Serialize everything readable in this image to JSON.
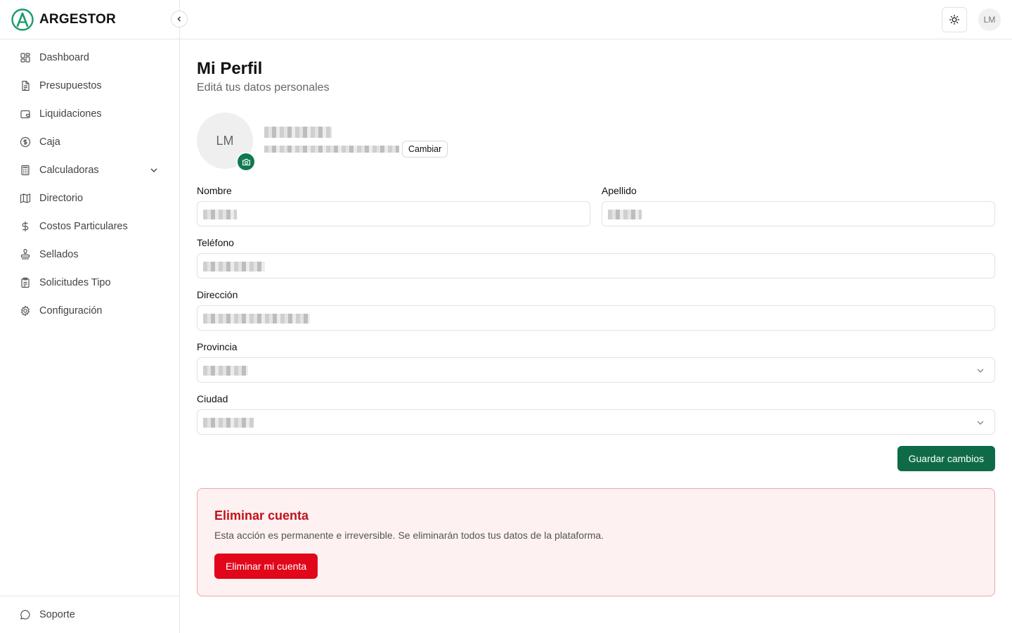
{
  "brand": {
    "name": "ARGESTOR",
    "accent": "#1a9b6a"
  },
  "sidebar": {
    "items": [
      {
        "label": "Dashboard",
        "icon": "dashboard-icon"
      },
      {
        "label": "Presupuestos",
        "icon": "file-text-icon"
      },
      {
        "label": "Liquidaciones",
        "icon": "wallet-icon"
      },
      {
        "label": "Caja",
        "icon": "dollar-circle-icon"
      },
      {
        "label": "Calculadoras",
        "icon": "calculator-icon",
        "expandable": true
      },
      {
        "label": "Directorio",
        "icon": "map-icon"
      },
      {
        "label": "Costos Particulares",
        "icon": "dollar-sign-icon"
      },
      {
        "label": "Sellados",
        "icon": "stamp-icon"
      },
      {
        "label": "Solicitudes Tipo",
        "icon": "clipboard-icon"
      },
      {
        "label": "Configuración",
        "icon": "gear-icon"
      }
    ],
    "footer": {
      "label": "Soporte",
      "icon": "chat-bubble-icon"
    }
  },
  "topbar": {
    "user_initials": "LM",
    "theme_icon": "sun-icon"
  },
  "page": {
    "title": "Mi Perfil",
    "subtitle": "Editá tus datos personales"
  },
  "profile": {
    "initials": "LM",
    "change_label": "Cambiar"
  },
  "form": {
    "nombre_label": "Nombre",
    "apellido_label": "Apellido",
    "telefono_label": "Teléfono",
    "direccion_label": "Dirección",
    "provincia_label": "Provincia",
    "ciudad_label": "Ciudad",
    "save_label": "Guardar cambios"
  },
  "danger": {
    "title": "Eliminar cuenta",
    "description": "Esta acción es permanente e irreversible. Se eliminarán todos tus datos de la plataforma.",
    "button_label": "Eliminar mi cuenta",
    "color": "#e2061a"
  }
}
